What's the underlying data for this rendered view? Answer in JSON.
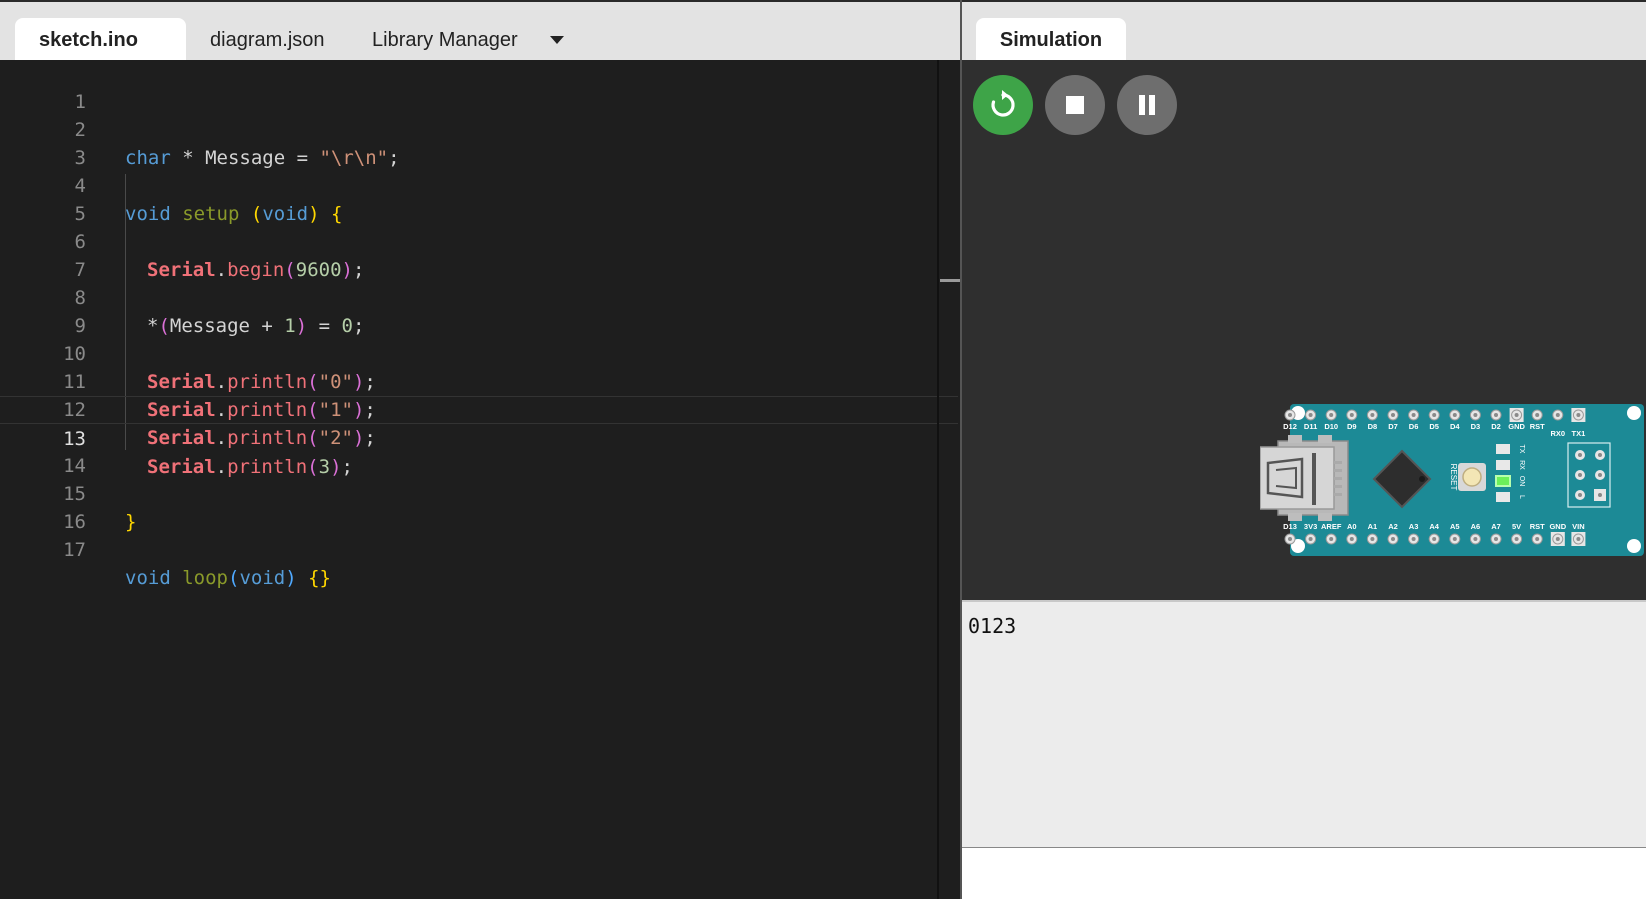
{
  "editor": {
    "tabs": {
      "sketch": "sketch.ino",
      "diagram": "diagram.json",
      "library": "Library Manager"
    },
    "lines": [
      {
        "num": "1"
      },
      {
        "num": "2"
      },
      {
        "num": "3"
      },
      {
        "num": "4"
      },
      {
        "num": "5"
      },
      {
        "num": "6"
      },
      {
        "num": "7"
      },
      {
        "num": "8"
      },
      {
        "num": "9"
      },
      {
        "num": "10"
      },
      {
        "num": "11"
      },
      {
        "num": "12"
      },
      {
        "num": "13"
      },
      {
        "num": "14"
      },
      {
        "num": "15"
      },
      {
        "num": "16"
      },
      {
        "num": "17"
      }
    ],
    "tokens": {
      "l2": [
        "char",
        " * Message = ",
        "\"\\r\\n\"",
        ";"
      ],
      "l4": [
        "void",
        " ",
        "setup",
        " ",
        "(",
        "void",
        ")",
        " ",
        "{"
      ],
      "l6": [
        "Serial",
        ".",
        "begin",
        "(",
        "9600",
        ")",
        ";"
      ],
      "l8": [
        "*",
        "(",
        "Message + ",
        "1",
        ")",
        " = ",
        "0",
        ";"
      ],
      "l10": [
        "Serial",
        ".",
        "println",
        "(",
        "\"0\"",
        ")",
        ";"
      ],
      "l11": [
        "Serial",
        ".",
        "println",
        "(",
        "\"1\"",
        ")",
        ";"
      ],
      "l12": [
        "Serial",
        ".",
        "println",
        "(",
        "\"2\"",
        ")",
        ";"
      ],
      "l13": [
        "Serial",
        ".",
        "println",
        "(",
        "3",
        ")",
        ";"
      ],
      "l15": [
        "}"
      ],
      "l17": [
        "void",
        " ",
        "loop",
        "(",
        "void",
        ")",
        " ",
        "{}"
      ]
    },
    "current_line": 13
  },
  "simulation": {
    "tab_label": "Simulation",
    "serial_output": "0123",
    "colors": {
      "restart": "#3ea448",
      "control": "#6e6e6e",
      "board": "#1c8a96",
      "led_on": "#6cf05a"
    },
    "board": {
      "top_pins": [
        "D12",
        "D11",
        "D10",
        "D9",
        "D8",
        "D7",
        "D6",
        "D5",
        "D4",
        "D3",
        "D2",
        "GND",
        "RST",
        "RX0",
        "TX1"
      ],
      "bottom_pins": [
        "D13",
        "3V3",
        "AREF",
        "A0",
        "A1",
        "A2",
        "A3",
        "A4",
        "A5",
        "A6",
        "A7",
        "5V",
        "RST",
        "GND",
        "VIN"
      ],
      "led_labels": [
        "TX",
        "RX",
        "ON",
        "L"
      ],
      "reset_label": "RESET"
    }
  }
}
